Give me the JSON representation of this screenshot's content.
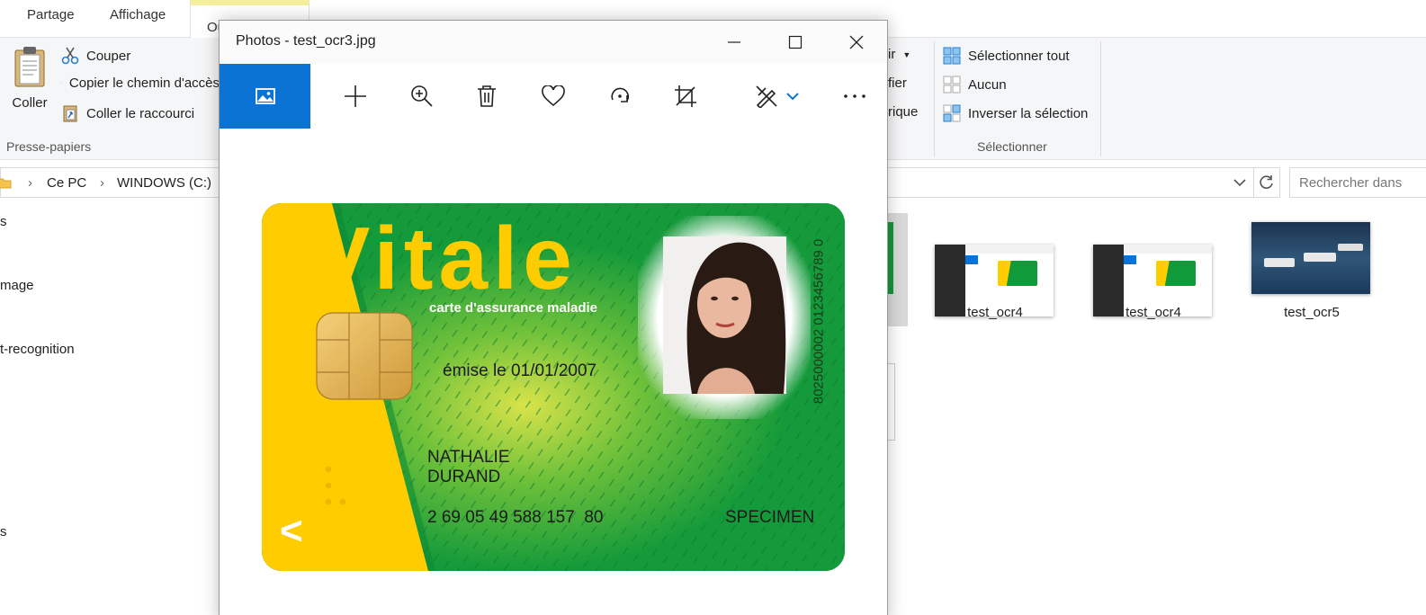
{
  "explorer": {
    "ribbon_tabs": [
      "Partage",
      "Affichage",
      "Outils d'image"
    ],
    "clipboard": {
      "paste_label": "Coller",
      "cut_label": "Couper",
      "copy_path_label": "Copier le chemin d'accès",
      "paste_shortcut_label": "Coller le raccourci",
      "group_label": "Presse-papiers"
    },
    "open_group_partial": [
      "ir",
      "fier",
      "rique"
    ],
    "select": {
      "select_all_label": "Sélectionner tout",
      "none_label": "Aucun",
      "invert_label": "Inverser la sélection",
      "group_label": "Sélectionner"
    },
    "breadcrumb": [
      "Ce PC",
      "WINDOWS (C:)"
    ],
    "search_placeholder": "Rechercher dans",
    "sidebar_items": [
      "s",
      "mage",
      "t-recognition",
      "s"
    ],
    "files": [
      {
        "name": "test_ocr4"
      },
      {
        "name": "test_ocr4"
      },
      {
        "name": "test_ocr5"
      }
    ]
  },
  "photos": {
    "window_title": "Photos - test_ocr3.jpg",
    "toolbar_icons": [
      "home-icon",
      "add-icon",
      "zoom-icon",
      "delete-icon",
      "favorite-icon",
      "rotate-icon",
      "crop-icon",
      "edit-icon",
      "chevron-down-icon",
      "more-icon"
    ],
    "accent_color": "#0b73d4",
    "card": {
      "brand": "Vitale",
      "subtitle": "carte d'assurance maladie",
      "issued": "émise le 01/01/2007",
      "first_name": "NATHALIE",
      "last_name": "DURAND",
      "number": "2 69 05 49 588 157  80",
      "specimen": "SPECIMEN",
      "vertical_number": "8025000002 0123456789 0",
      "arrow": "<",
      "colors": {
        "green": "#119a3a",
        "yellow": "#ffcc00"
      }
    }
  }
}
